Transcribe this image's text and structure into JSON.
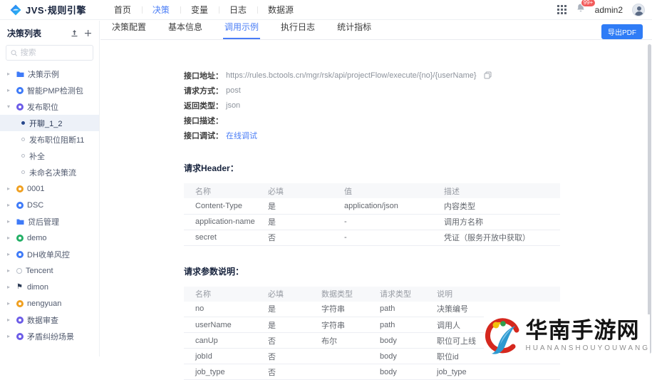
{
  "colors": {
    "accent": "#4a7df6",
    "button": "#2f7cf6",
    "badge": "#f25b5b",
    "selected_row": "#edf1f8"
  },
  "navbar": {
    "brand": "JVS·规则引擎",
    "menu": [
      {
        "label": "首页",
        "active": false
      },
      {
        "label": "决策",
        "active": true
      },
      {
        "label": "变量",
        "active": false
      },
      {
        "label": "日志",
        "active": false
      },
      {
        "label": "数据源",
        "active": false
      }
    ],
    "badge": "99+",
    "username": "admin2"
  },
  "sidebar": {
    "title": "决策列表",
    "search_placeholder": "搜索",
    "tree": [
      {
        "label": "决策示例",
        "icon": "folder",
        "color": "#3f7bf8"
      },
      {
        "label": "智能PMP检测包",
        "icon": "app",
        "color": "#3f7bf8"
      },
      {
        "label": "发布职位",
        "icon": "app",
        "color": "#6c5ce7",
        "expanded": true,
        "children": [
          {
            "label": "开聊_1_2",
            "selected": true
          },
          {
            "label": "发布职位阻断11",
            "selected": false
          },
          {
            "label": "补全",
            "selected": false
          },
          {
            "label": "未命名决策流",
            "selected": false
          }
        ]
      },
      {
        "label": "0001",
        "icon": "app",
        "color": "#f0a020"
      },
      {
        "label": "DSC",
        "icon": "app",
        "color": "#3f7bf8"
      },
      {
        "label": "贷后管理",
        "icon": "folder",
        "color": "#3f7bf8"
      },
      {
        "label": "demo",
        "icon": "app",
        "color": "#23b066"
      },
      {
        "label": "DH收单风控",
        "icon": "app",
        "color": "#3f7bf8"
      },
      {
        "label": "Tencent",
        "icon": "ring",
        "color": "#b9bfc9"
      },
      {
        "label": "dimon",
        "icon": "flag",
        "color": "#2b3a55"
      },
      {
        "label": "nengyuan",
        "icon": "app",
        "color": "#f0a020"
      },
      {
        "label": "数据审查",
        "icon": "app",
        "color": "#6c5ce7"
      },
      {
        "label": "矛盾纠纷场景",
        "icon": "app",
        "color": "#6c5ce7"
      }
    ]
  },
  "tabs": {
    "items": [
      "决策配置",
      "基本信息",
      "调用示例",
      "执行日志",
      "统计指标"
    ],
    "active_index": 2,
    "export_label": "导出PDF"
  },
  "api": {
    "fields": [
      {
        "label": "接口地址：",
        "value": "https://rules.bctools.cn/mgr/rsk/api/projectFlow/execute/{no}/{userName}",
        "copy": true
      },
      {
        "label": "请求方式：",
        "value": "post"
      },
      {
        "label": "返回类型：",
        "value": "json"
      },
      {
        "label": "接口描述：",
        "value": ""
      },
      {
        "label": "接口调试：",
        "link": "在线调试"
      }
    ]
  },
  "header_table": {
    "title": "请求Header：",
    "columns": [
      "名称",
      "必填",
      "值",
      "描述"
    ],
    "rows": [
      [
        "Content-Type",
        "是",
        "application/json",
        "内容类型"
      ],
      [
        "application-name",
        "是",
        "-",
        "调用方名称"
      ],
      [
        "secret",
        "否",
        "-",
        "凭证（服务开放中获取）"
      ]
    ]
  },
  "params_table": {
    "title": "请求参数说明：",
    "columns": [
      "名称",
      "必填",
      "数据类型",
      "请求类型",
      "说明"
    ],
    "rows": [
      [
        "no",
        "是",
        "字符串",
        "path",
        "决策编号"
      ],
      [
        "userName",
        "是",
        "字符串",
        "path",
        "调用人"
      ],
      [
        "canUp",
        "否",
        "布尔",
        "body",
        "职位可上线"
      ],
      [
        "jobId",
        "否",
        "",
        "body",
        "职位id"
      ],
      [
        "job_type",
        "否",
        "",
        "body",
        "job_type"
      ]
    ]
  },
  "watermark": {
    "title": "华南手游网",
    "subtitle": "HUANANSHOUYOUWANG"
  }
}
